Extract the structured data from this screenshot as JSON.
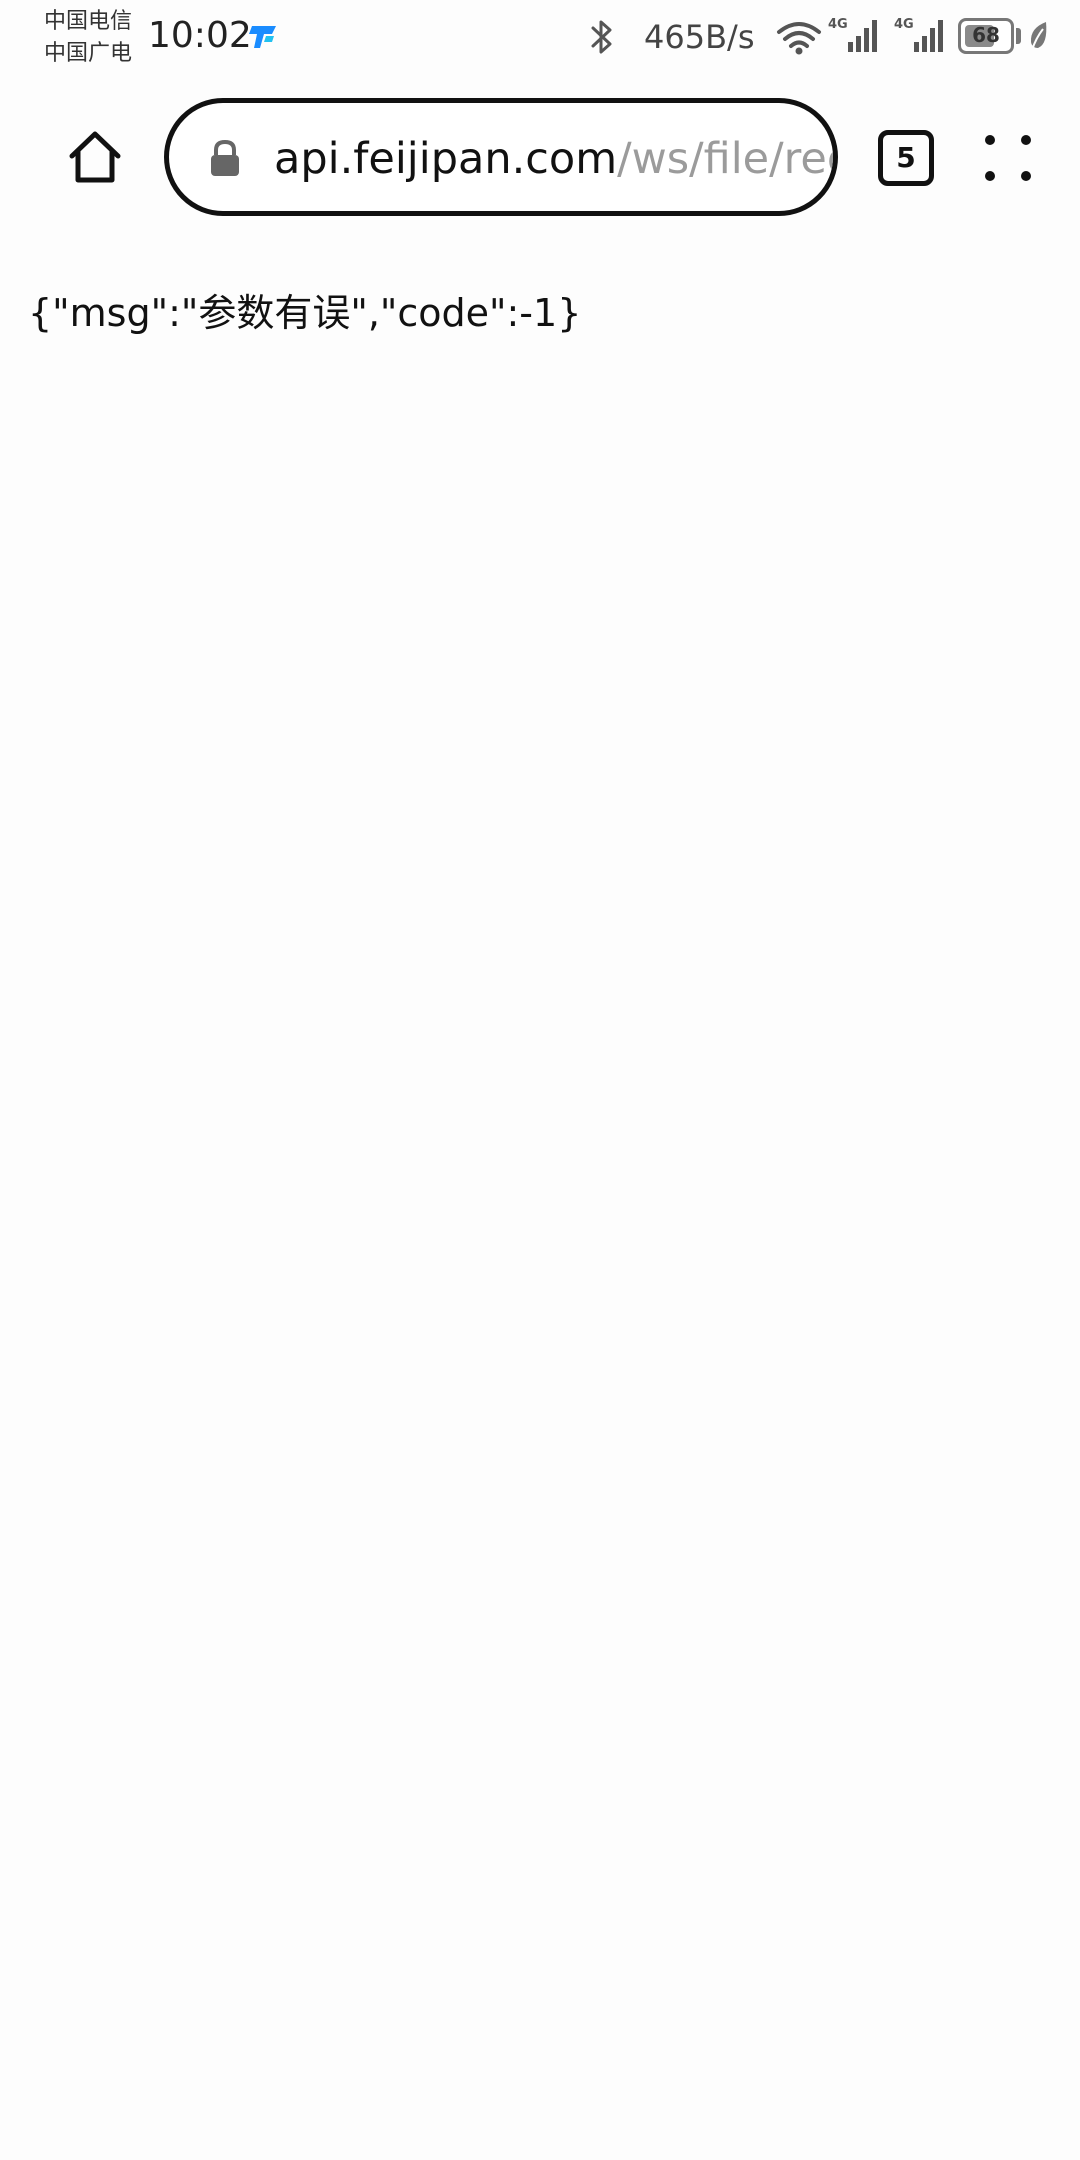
{
  "status_bar": {
    "carrier_1": "中国电信",
    "carrier_2": "中国广电",
    "time": "10:02",
    "net_speed": "465B/s",
    "network_type_1": "4G",
    "network_type_2": "4G",
    "battery_level": "68",
    "battery_fraction": 0.68,
    "icons": [
      "notification-app-icon",
      "bluetooth-icon",
      "wifi-icon",
      "cellular-signal-icon",
      "battery-icon",
      "power-saving-leaf-icon"
    ]
  },
  "toolbar": {
    "url_domain": "api.feijipan.com",
    "url_path": "/ws/file/rec",
    "tab_count": "5",
    "icons": [
      "home-icon",
      "lock-icon",
      "tab-switcher-icon",
      "menu-dots-icon"
    ]
  },
  "page": {
    "body_text": "{\"msg\":\"参数有误\",\"code\":-1}"
  },
  "colors": {
    "background": "#fdfdfd",
    "text": "#111111",
    "url_path": "#9b9b9b",
    "notification_icon": "#1a8cff"
  }
}
